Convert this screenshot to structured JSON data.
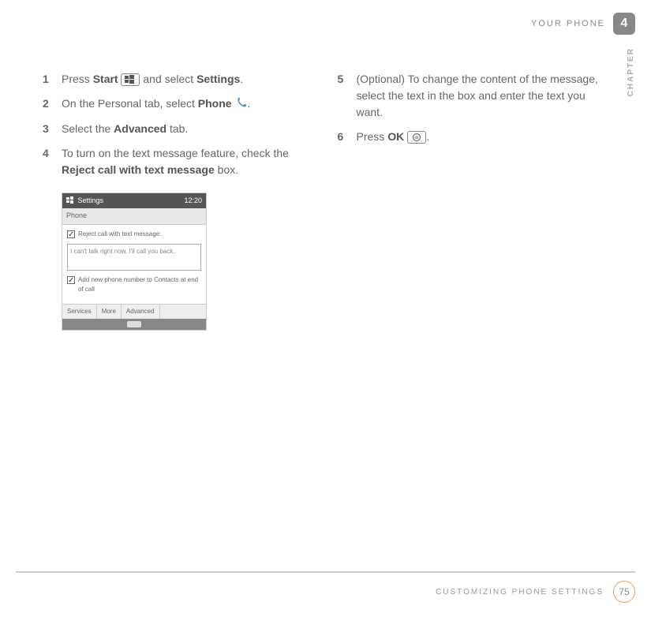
{
  "header": {
    "title": "YOUR PHONE",
    "chapterNumber": "4",
    "chapterLabel": "CHAPTER"
  },
  "steps": {
    "s1": {
      "num": "1",
      "press": "Press ",
      "start": "Start",
      "select": " and select ",
      "settings": "Settings",
      "tail": "."
    },
    "s2": {
      "num": "2",
      "pre": "On the Personal tab, select ",
      "phone": "Phone",
      "tail": "."
    },
    "s3": {
      "num": "3",
      "pre": "Select the ",
      "advanced": "Advanced",
      "tail": " tab."
    },
    "s4": {
      "num": "4",
      "pre": "To turn on the text message feature, check the ",
      "reject": "Reject call with text message",
      "tail": " box."
    },
    "s5": {
      "num": "5",
      "text": "(Optional) To change the content of the message, select the text in the box and enter the text you want."
    },
    "s6": {
      "num": "6",
      "pre": "Press ",
      "ok": "OK",
      "tail": "."
    }
  },
  "screenshot": {
    "windowTitle": "Settings",
    "time": "12:20",
    "paneTitle": "Phone",
    "checkbox1": "Reject call with text message:",
    "textboxValue": "I can't talk right now. I'll call you back.",
    "checkbox2": "Add new phone number to Contacts at end of call",
    "tabs": [
      "Services",
      "More",
      "Advanced"
    ]
  },
  "footer": {
    "title": "CUSTOMIZING PHONE SETTINGS",
    "page": "75"
  }
}
